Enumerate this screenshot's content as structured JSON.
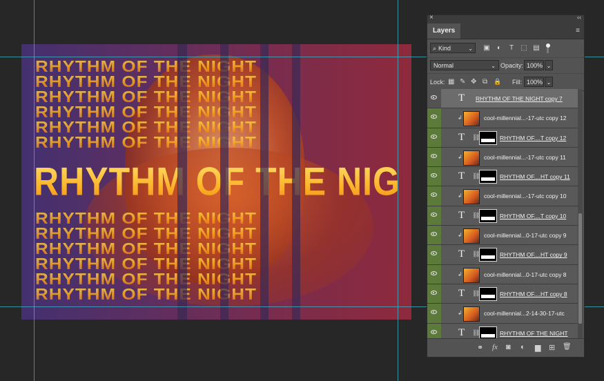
{
  "canvas": {
    "main_title": "RHYTHM OF THE NIGHT",
    "echo_text": "RHYTHM OF THE NIGHT"
  },
  "panel": {
    "close_glyph": "×",
    "collapse_glyph": "‹‹",
    "tab_label": "Layers",
    "menu_glyph": "≡",
    "filter": {
      "kind_label": "Kind",
      "search_glyph": "⌕",
      "caret": "⌄"
    },
    "filter_icons": [
      "▣",
      "◐",
      "T",
      "⬚",
      "▤"
    ],
    "blend_mode": "Normal",
    "opacity_label": "Opacity:",
    "opacity_value": "100%",
    "lock_label": "Lock:",
    "lock_icons": [
      "▦",
      "✎",
      "✥",
      "⧉",
      "🔒"
    ],
    "fill_label": "Fill:",
    "fill_value": "100%",
    "chev": "⌄",
    "layers": [
      {
        "type": "text",
        "name": "RHYTHM OF THE NIGHT copy 7",
        "visible": true,
        "eye_bg": false,
        "selected": true
      },
      {
        "type": "image",
        "name": "cool-millennial...-17-utc copy 12",
        "visible": true,
        "eye_bg": true,
        "clipped": true
      },
      {
        "type": "text-mask",
        "name": "RHYTHM OF....T copy 12",
        "visible": true,
        "eye_bg": true
      },
      {
        "type": "image",
        "name": "cool-millennial...-17-utc copy 11",
        "visible": true,
        "eye_bg": true,
        "clipped": true
      },
      {
        "type": "text-mask",
        "name": "RHYTHM OF....HT copy 11",
        "visible": true,
        "eye_bg": true
      },
      {
        "type": "image",
        "name": "cool-millennial...-17-utc copy 10",
        "visible": true,
        "eye_bg": true,
        "clipped": true
      },
      {
        "type": "text-mask",
        "name": "RHYTHM OF....T copy 10",
        "visible": true,
        "eye_bg": true
      },
      {
        "type": "image",
        "name": "cool-millennial...0-17-utc copy 9",
        "visible": true,
        "eye_bg": true,
        "clipped": true
      },
      {
        "type": "text-mask",
        "name": "RHYTHM OF....HT copy 9",
        "visible": true,
        "eye_bg": true
      },
      {
        "type": "image",
        "name": "cool-millennial...0-17-utc copy 8",
        "visible": true,
        "eye_bg": true,
        "clipped": true
      },
      {
        "type": "text-mask",
        "name": "RHYTHM OF....HT copy 8",
        "visible": true,
        "eye_bg": true
      },
      {
        "type": "image",
        "name": "cool-millennial...2-14-30-17-utc",
        "visible": true,
        "eye_bg": true,
        "clipped": true
      },
      {
        "type": "text-mask",
        "name": "RHYTHM OF THE NIGHT",
        "visible": true,
        "eye_bg": true
      }
    ],
    "footer_icons": [
      "⚭",
      "fx",
      "◙",
      "◐",
      "▆",
      "⊞",
      "🗑"
    ]
  }
}
